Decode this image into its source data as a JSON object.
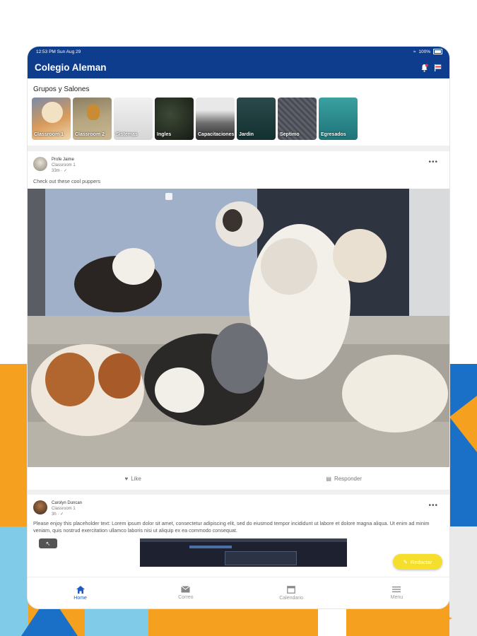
{
  "colors": {
    "app_bar": "#0f3d8e",
    "accent": "#1e5cc4",
    "fab": "#f6df2c",
    "bg_orange": "#f5a01f",
    "bg_blue": "#1a6fc7",
    "bg_light_blue": "#7fcbe8"
  },
  "status_bar": {
    "time_date": "12:53 PM   Sun Aug 29",
    "battery": "100%"
  },
  "app_bar": {
    "title": "Colegio Aleman",
    "icons": [
      "bell-icon",
      "flag-icon"
    ]
  },
  "groups": {
    "title": "Grupos y Salones",
    "items": [
      {
        "label": "Classroom 1"
      },
      {
        "label": "Classroom 2"
      },
      {
        "label": "Sistemas"
      },
      {
        "label": "Ingles"
      },
      {
        "label": "Capacitaciones"
      },
      {
        "label": "Jardin"
      },
      {
        "label": "Septimo"
      },
      {
        "label": "Egresados"
      }
    ]
  },
  "posts": [
    {
      "author": "Profe Jaime",
      "group": "Classroom 1",
      "time": "33m · ✓",
      "text": "Check out these cool puppers",
      "more": "•••"
    },
    {
      "author": "Carolyn Duncan",
      "group": "Classroom 1",
      "time": "3h · ✓",
      "text": "Please enjoy this placeholder text: Lorem ipsum dolor sit amet, consectetur adipiscing elit, sed do eiusmod tempor incididunt ut labore et dolore magna aliqua. Ut enim ad minim veniam, quis nostrud exercitation ullamco laboris nisi ut aliquip ex ea commodo consequat.",
      "more": "•••"
    }
  ],
  "post_actions": {
    "like": "Like",
    "reply": "Responder"
  },
  "fab": {
    "label": "Redactar"
  },
  "tabs": [
    {
      "label": "Home",
      "icon": "home-icon"
    },
    {
      "label": "Correo",
      "icon": "mail-icon"
    },
    {
      "label": "Calendario",
      "icon": "calendar-icon"
    },
    {
      "label": "Menu",
      "icon": "menu-icon"
    }
  ]
}
